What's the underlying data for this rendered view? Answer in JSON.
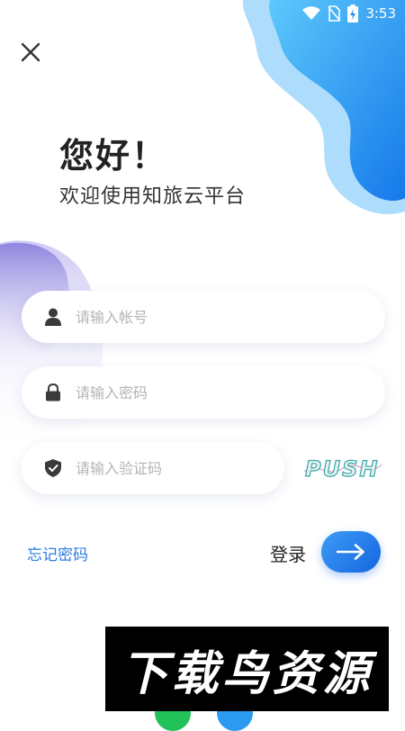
{
  "status_bar": {
    "time": "3:53"
  },
  "header": {
    "greeting": "您好！",
    "welcome": "欢迎使用知旅云平台"
  },
  "form": {
    "account_placeholder": "请输入帐号",
    "password_placeholder": "请输入密码",
    "captcha_placeholder": "请输入验证码",
    "captcha_text": "PUSH"
  },
  "actions": {
    "forgot_password": "忘记密码",
    "login_label": "登录"
  },
  "watermark": {
    "text": "下载鸟资源"
  },
  "colors": {
    "accent": "#2b7de3",
    "blob_blue": "#1f8ef1",
    "blob_purple": "#8a86e0"
  }
}
